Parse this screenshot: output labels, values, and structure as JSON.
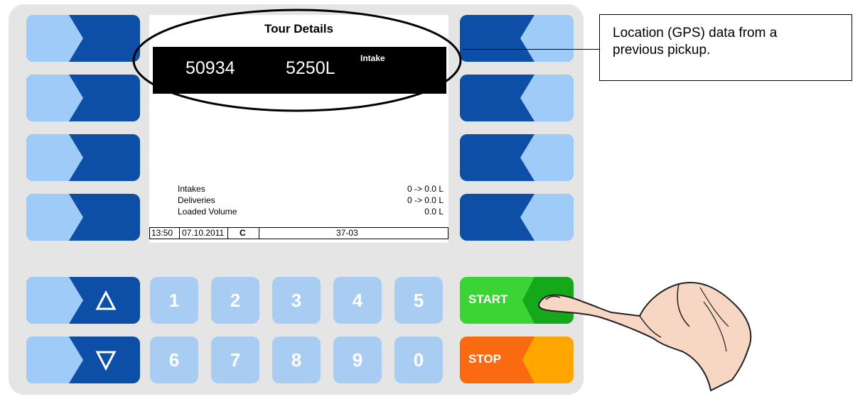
{
  "screen": {
    "title": "Tour Details",
    "banner": {
      "id": "50934",
      "volume": "5250L",
      "type": "Intake"
    },
    "summary": [
      {
        "label": "Intakes",
        "value": "0 -> 0.0 L"
      },
      {
        "label": "Deliveries",
        "value": "0 -> 0.0 L"
      },
      {
        "label": "Loaded Volume",
        "value": "0.0 L"
      }
    ],
    "status": {
      "time": "13:50",
      "date": "07.10.2011",
      "mode": "C",
      "code": "37-03"
    }
  },
  "keypad": {
    "row1": [
      "1",
      "2",
      "3",
      "4",
      "5"
    ],
    "row2": [
      "6",
      "7",
      "8",
      "9",
      "0"
    ]
  },
  "buttons": {
    "start": "START",
    "stop": "STOP"
  },
  "callout": {
    "line1": "Location (GPS) data from a",
    "line2": "previous pickup."
  },
  "colors": {
    "dark_blue": "#0d4fa6",
    "light_blue": "#9ecbf7",
    "key_blue": "#a9cdf2",
    "green": "#3ad435",
    "dark_green": "#14a81a",
    "orange": "#fa6a10",
    "light_orange": "#ffa500"
  }
}
